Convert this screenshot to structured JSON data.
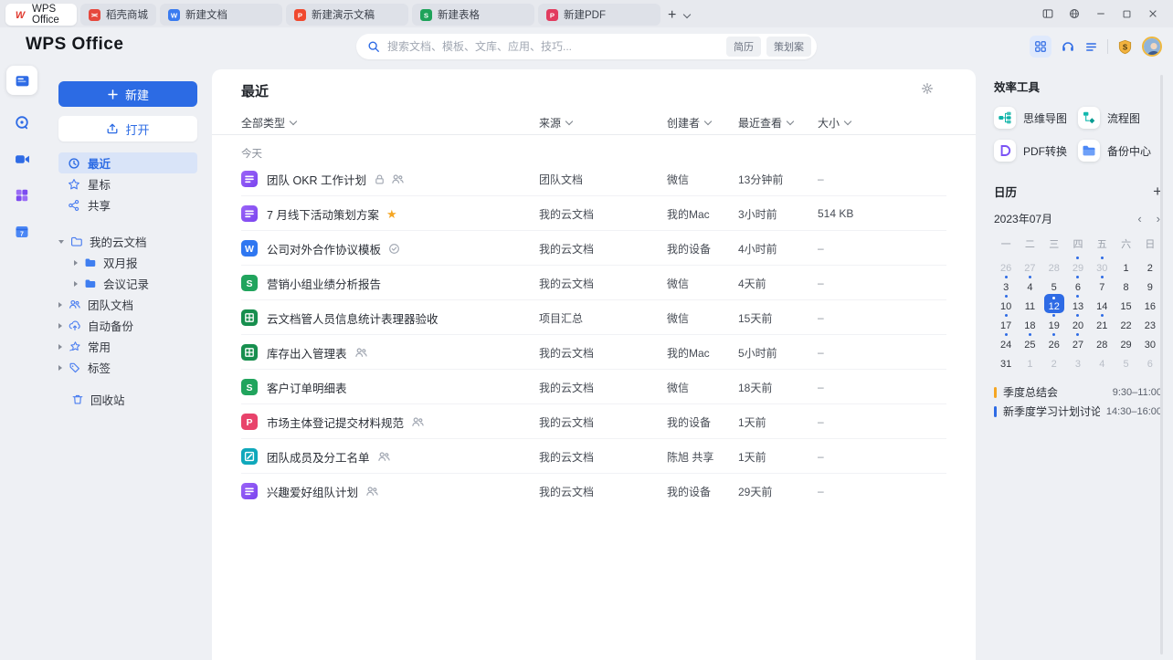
{
  "tabbar": {
    "tabs": [
      {
        "label": "WPS Office",
        "icon": "wps-logo-icon",
        "active": true
      },
      {
        "label": "稻壳商城",
        "icon": "docer-icon",
        "doc": false
      },
      {
        "label": "新建文档",
        "icon": "writer-icon",
        "doc": true
      },
      {
        "label": "新建演示文稿",
        "icon": "presentation-icon",
        "doc": true
      },
      {
        "label": "新建表格",
        "icon": "spreadsheet-icon",
        "doc": true
      },
      {
        "label": "新建PDF",
        "icon": "pdf-tab-icon",
        "doc": true
      }
    ],
    "window_controls": [
      "split-view-icon",
      "globe-icon",
      "minimize-icon",
      "maximize-icon",
      "close-icon"
    ]
  },
  "header": {
    "logo": "WPS Office",
    "search": {
      "placeholder": "搜索文档、模板、文库、应用、技巧...",
      "tags": [
        "简历",
        "策划案"
      ]
    },
    "right_icons": [
      "apps-grid-icon",
      "headset-icon",
      "menu-icon",
      "vip-badge-icon",
      "avatar"
    ]
  },
  "rail": {
    "items": [
      "docs-home-icon",
      "recent-clock-icon",
      "meeting-video-icon",
      "apps-purple-icon",
      "calendar-7-icon"
    ]
  },
  "sidebar": {
    "new_label": "新建",
    "open_label": "打开",
    "nav": [
      {
        "label": "最近",
        "icon": "clock-icon",
        "active": true
      },
      {
        "label": "星标",
        "icon": "star-outline-icon",
        "active": false
      },
      {
        "label": "共享",
        "icon": "share-icon",
        "active": false
      }
    ],
    "tree": [
      {
        "label": "我的云文档",
        "icon": "cloud-folder-icon",
        "caret": "down",
        "level": 1
      },
      {
        "label": "双月报",
        "icon": "folder-icon",
        "caret": "right",
        "level": 2
      },
      {
        "label": "会议记录",
        "icon": "folder-icon",
        "caret": "right",
        "level": 2
      },
      {
        "label": "团队文档",
        "icon": "team-icon",
        "caret": "right",
        "level": 1
      },
      {
        "label": "自动备份",
        "icon": "cloud-backup-icon",
        "caret": "right",
        "level": 1
      },
      {
        "label": "常用",
        "icon": "frequent-star-icon",
        "caret": "right",
        "level": 1
      },
      {
        "label": "标签",
        "icon": "tag-icon",
        "caret": "right",
        "level": 1
      }
    ],
    "trash": {
      "label": "回收站",
      "icon": "trash-icon"
    }
  },
  "main": {
    "title": "最近",
    "filters": [
      "全部类型",
      "来源",
      "创建者",
      "最近查看",
      "大小"
    ],
    "group_label": "今天",
    "documents": [
      {
        "icon": "docs-file-icon",
        "title": "团队 OKR 工作计划",
        "badges": [
          "lock",
          "members"
        ],
        "source": "团队文档",
        "creator": "微信",
        "viewed": "13分钟前",
        "size": "–"
      },
      {
        "icon": "docs-file-icon",
        "title": "7 月线下活动策划方案",
        "badges": [
          "star"
        ],
        "source": "我的云文档",
        "creator": "我的Mac",
        "viewed": "3小时前",
        "size": "514 KB"
      },
      {
        "icon": "word-file-icon",
        "title": "公司对外合作协议模板",
        "badges": [
          "template"
        ],
        "source": "我的云文档",
        "creator": "我的设备",
        "viewed": "4小时前",
        "size": "–"
      },
      {
        "icon": "sheet-file-icon",
        "title": "营销小组业绩分析报告",
        "badges": [],
        "source": "我的云文档",
        "creator": "微信",
        "viewed": "4天前",
        "size": "–"
      },
      {
        "icon": "smartsheet-file-icon",
        "title": "云文档管人员信息统计表理器验收",
        "badges": [],
        "source": "项目汇总",
        "creator": "微信",
        "viewed": "15天前",
        "size": "–"
      },
      {
        "icon": "smartsheet-file-icon",
        "title": "库存出入管理表",
        "badges": [
          "members"
        ],
        "source": "我的云文档",
        "creator": "我的Mac",
        "viewed": "5小时前",
        "size": "–"
      },
      {
        "icon": "sheet-file-icon",
        "title": "客户订单明细表",
        "badges": [],
        "source": "我的云文档",
        "creator": "微信",
        "viewed": "18天前",
        "size": "–"
      },
      {
        "icon": "pdf-file-icon",
        "title": "市场主体登记提交材料规范",
        "badges": [
          "members"
        ],
        "source": "我的云文档",
        "creator": "我的设备",
        "viewed": "1天前",
        "size": "–"
      },
      {
        "icon": "form-file-icon",
        "title": "团队成员及分工名单",
        "badges": [
          "members"
        ],
        "source": "我的云文档",
        "creator": "陈旭 共享",
        "viewed": "1天前",
        "size": "–"
      },
      {
        "icon": "docs-file-icon",
        "title": "兴趣爱好组队计划",
        "badges": [
          "members"
        ],
        "source": "我的云文档",
        "creator": "我的设备",
        "viewed": "29天前",
        "size": "–"
      }
    ]
  },
  "tools": {
    "title": "效率工具",
    "items": [
      {
        "label": "思维导图",
        "icon": "mindmap-icon"
      },
      {
        "label": "流程图",
        "icon": "flowchart-icon"
      },
      {
        "label": "PDF转换",
        "icon": "pdf-convert-icon"
      },
      {
        "label": "备份中心",
        "icon": "backup-center-icon"
      }
    ]
  },
  "calendar": {
    "title": "日历",
    "month": "2023年07月",
    "weekdays": [
      "一",
      "二",
      "三",
      "四",
      "五",
      "六",
      "日"
    ],
    "days": [
      {
        "n": 26,
        "muted": true
      },
      {
        "n": 27,
        "muted": true
      },
      {
        "n": 28,
        "muted": true
      },
      {
        "n": 29,
        "muted": true,
        "dot": true
      },
      {
        "n": 30,
        "muted": true,
        "dot": true
      },
      {
        "n": 1
      },
      {
        "n": 2
      },
      {
        "n": 3,
        "dot": true
      },
      {
        "n": 4,
        "dot": true
      },
      {
        "n": 5
      },
      {
        "n": 6,
        "dot": true
      },
      {
        "n": 7,
        "dot": true
      },
      {
        "n": 8
      },
      {
        "n": 9
      },
      {
        "n": 10,
        "dot": true
      },
      {
        "n": 11
      },
      {
        "n": 12,
        "selected": true,
        "dot": true
      },
      {
        "n": 13,
        "dot": true
      },
      {
        "n": 14
      },
      {
        "n": 15
      },
      {
        "n": 16
      },
      {
        "n": 17,
        "dot": true
      },
      {
        "n": 18
      },
      {
        "n": 19,
        "dot": true
      },
      {
        "n": 20,
        "dot": true
      },
      {
        "n": 21,
        "dot": true
      },
      {
        "n": 22
      },
      {
        "n": 23
      },
      {
        "n": 24,
        "dot": true
      },
      {
        "n": 25,
        "dot": true
      },
      {
        "n": 26,
        "dot": true
      },
      {
        "n": 27,
        "dot": true
      },
      {
        "n": 28
      },
      {
        "n": 29
      },
      {
        "n": 30
      },
      {
        "n": 31
      },
      {
        "n": 1,
        "muted": true
      },
      {
        "n": 2,
        "muted": true
      },
      {
        "n": 3,
        "muted": true
      },
      {
        "n": 4,
        "muted": true
      },
      {
        "n": 5,
        "muted": true
      },
      {
        "n": 6,
        "muted": true
      }
    ],
    "events": [
      {
        "title": "季度总结会",
        "time": "9:30–11:00",
        "color": "#f5a623"
      },
      {
        "title": "新季度学习计划讨论",
        "time": "14:30–16:00",
        "color": "#2e6be5"
      }
    ],
    "accent": "#2e6be5"
  }
}
